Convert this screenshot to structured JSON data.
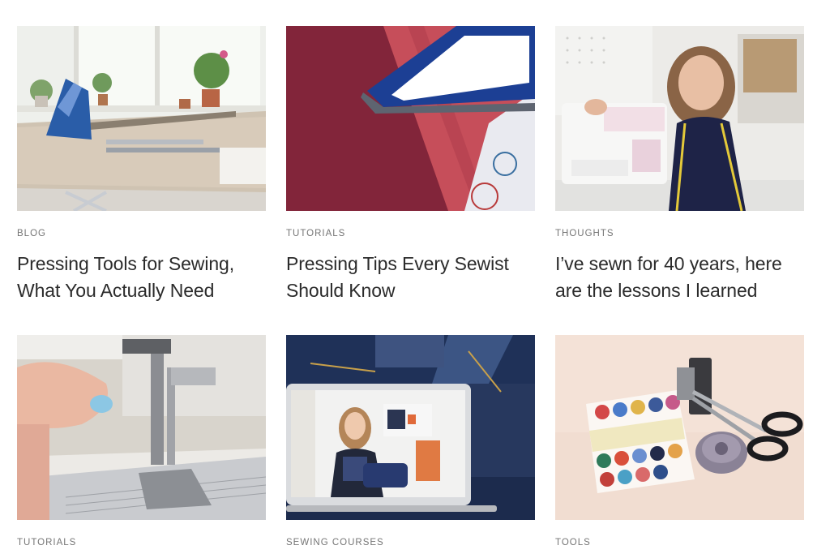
{
  "cards": [
    {
      "category": "BLOG",
      "title": "Pressing Tools for Sewing, What You Actually Need",
      "image": "iron-on-ironing-board-photo"
    },
    {
      "category": "TUTORIALS",
      "title": "Pressing Tips Every Sewist Should Know",
      "image": "iron-on-red-fabric-photo"
    },
    {
      "category": "THOUGHTS",
      "title": "I’ve sewn for 40 years, here are the lessons I learned",
      "image": "woman-with-sewing-machine-photo"
    },
    {
      "category": "TUTORIALS",
      "title": "",
      "image": "sewing-machine-presser-foot-photo"
    },
    {
      "category": "SEWING COURSES",
      "title": "",
      "image": "laptop-video-course-photo"
    },
    {
      "category": "TOOLS",
      "title": "",
      "image": "book-scissors-pincushion-photo"
    }
  ]
}
